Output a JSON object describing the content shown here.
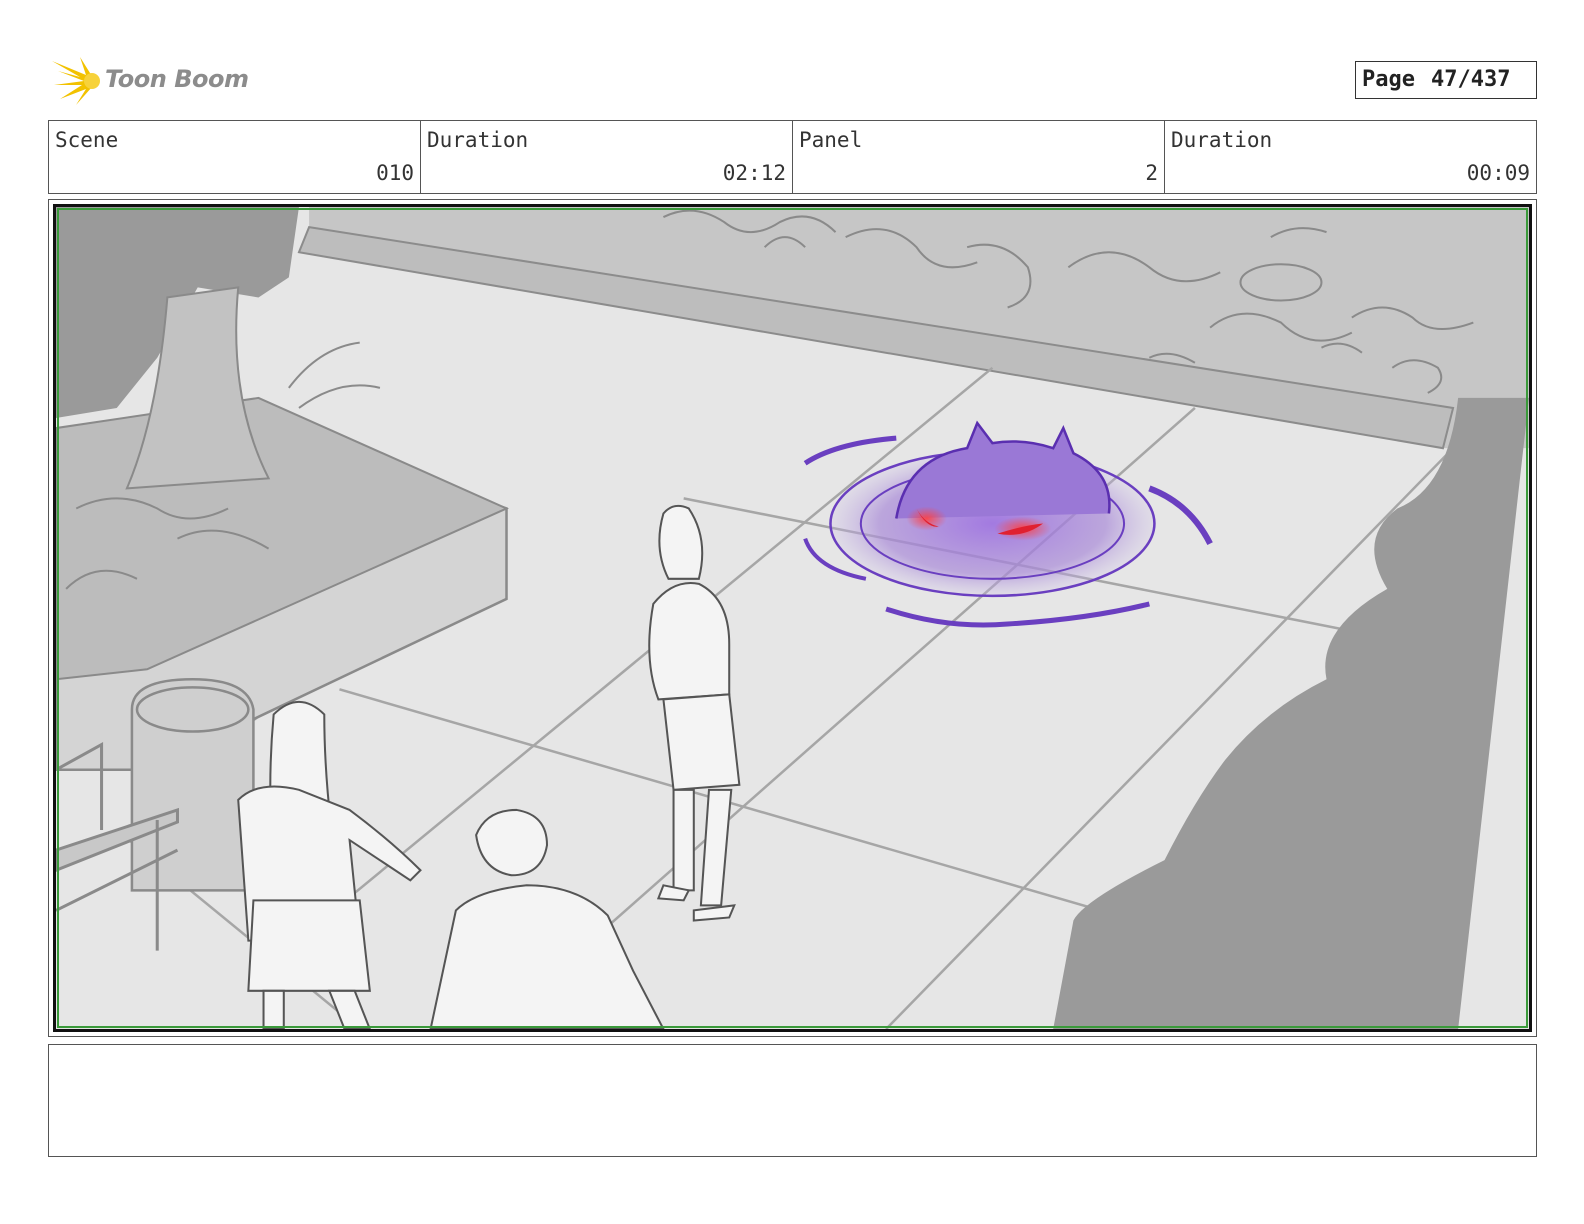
{
  "header": {
    "brand": "Toon Boom",
    "page_label": "Page",
    "page_number": "47/437"
  },
  "info": {
    "scene_label": "Scene",
    "scene_value": "010",
    "scene_duration_label": "Duration",
    "scene_duration_value": "02:12",
    "panel_label": "Panel",
    "panel_value": "2",
    "panel_duration_label": "Duration",
    "panel_duration_value": "00:09"
  },
  "notes": {
    "text": ""
  },
  "colors": {
    "logo_yellow": "#f2c200",
    "frame_green": "#3a9a3a",
    "portal_purple": "#7a4fc8",
    "eye_red": "#e02030"
  }
}
